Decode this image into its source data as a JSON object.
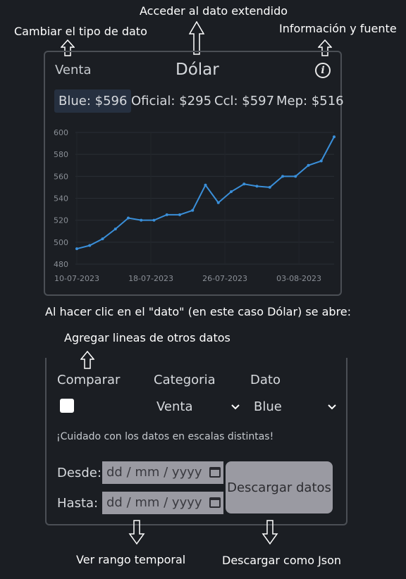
{
  "annotations": {
    "extended": "Acceder al dato extendido",
    "change_type": "Cambiar el tipo de dato",
    "info_source": "Información y fuente",
    "click_note": "Al hacer clic en el \"dato\" (en este caso Dólar) se abre:",
    "add_lines": "Agregar lineas de otros datos",
    "time_range": "Ver rango temporal",
    "download_json": "Descargar como Json"
  },
  "widget": {
    "type_label": "Venta",
    "title": "Dólar",
    "info_icon": "info-icon",
    "tabs": [
      {
        "label": "Blue: $596",
        "active": true
      },
      {
        "label": "Oficial: $295",
        "active": false
      },
      {
        "label": "Ccl: $597",
        "active": false
      },
      {
        "label": "Mep: $516",
        "active": false
      }
    ]
  },
  "chart_data": {
    "type": "line",
    "series_color": "#3a8fd9",
    "ylim": [
      480,
      600
    ],
    "yticks": [
      "600",
      "580",
      "560",
      "540",
      "520",
      "500",
      "480"
    ],
    "xtick_labels": [
      "10-07-2023",
      "18-07-2023",
      "26-07-2023",
      "03-08-2023"
    ],
    "xtick_index": [
      0,
      8,
      16,
      24
    ],
    "values": [
      494,
      497,
      503,
      512,
      522,
      520,
      520,
      525,
      525,
      529,
      552,
      536,
      546,
      553,
      551,
      550,
      560,
      560,
      570,
      574,
      596
    ]
  },
  "panel": {
    "compare_label": "Comparar",
    "category_label": "Categoria",
    "data_label": "Dato",
    "category_value": "Venta",
    "data_value": "Blue",
    "warning": "¡Cuidado con los datos en escalas distintas!",
    "from_label": "Desde:",
    "to_label": "Hasta:",
    "date_placeholder": "dd / mm / yyyy",
    "download_label": "Descargar datos"
  }
}
